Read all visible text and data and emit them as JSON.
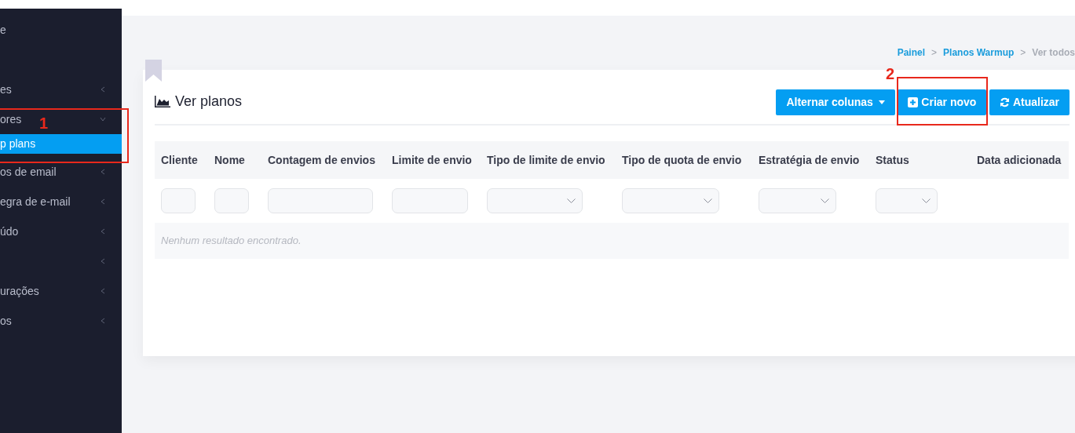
{
  "sidebar": {
    "items": [
      {
        "label": "e",
        "kind": "leaf",
        "selected": false
      },
      {
        "label": "es",
        "kind": "collapsed",
        "selected": false
      },
      {
        "label": "ores",
        "kind": "expanded",
        "selected": false
      },
      {
        "label": "p plans",
        "kind": "leaf",
        "selected": true
      },
      {
        "label": "os de email",
        "kind": "collapsed",
        "selected": false
      },
      {
        "label": "egra de e-mail",
        "kind": "collapsed",
        "selected": false
      },
      {
        "label": "údo",
        "kind": "collapsed",
        "selected": false
      },
      {
        "kind": "collapsed",
        "selected": false
      },
      {
        "label": "urações",
        "kind": "collapsed",
        "selected": false
      },
      {
        "label": "os",
        "kind": "collapsed",
        "selected": false
      }
    ]
  },
  "breadcrumb": [
    {
      "label": "Painel",
      "kind": "link"
    },
    {
      "label": ">",
      "kind": "separator"
    },
    {
      "label": "Planos Warmup",
      "kind": "link"
    },
    {
      "label": ">",
      "kind": "separator"
    },
    {
      "label": "Ver todos",
      "kind": "current"
    }
  ],
  "card": {
    "title": "Ver planos",
    "buttons": [
      {
        "label": "Alternar colunas",
        "kind": "dropdown"
      },
      {
        "label": "Criar novo",
        "kind": "create"
      },
      {
        "label": "Atualizar",
        "kind": "refresh"
      }
    ]
  },
  "table": {
    "columns": [
      {
        "label": "Cliente",
        "kind": "text"
      },
      {
        "label": "Nome",
        "kind": "text"
      },
      {
        "label": "Contagem de envios",
        "kind": "text"
      },
      {
        "label": "Limite de envio",
        "kind": "text"
      },
      {
        "label": "Tipo de limite de envio",
        "kind": "select"
      },
      {
        "label": "Tipo de quota de envio",
        "kind": "select"
      },
      {
        "label": "Estratégia de envio",
        "kind": "select"
      },
      {
        "label": "Status",
        "kind": "select"
      },
      {
        "label": "Data adicionada",
        "kind": "plain"
      }
    ],
    "empty_message": "Nenhum resultado encontrado."
  },
  "annotations": [
    {
      "label": "1"
    },
    {
      "label": "2"
    }
  ]
}
